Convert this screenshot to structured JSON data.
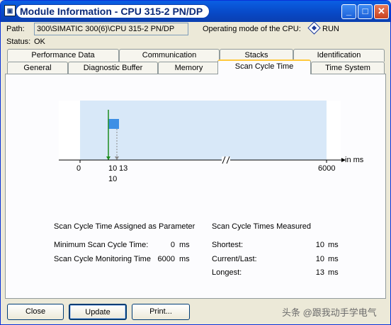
{
  "window": {
    "title": "Module Information - CPU 315-2 PN/DP",
    "icon": "siemens-cpu-icon"
  },
  "title_buttons": {
    "minimize": "_",
    "maximize": "□",
    "close": "✕"
  },
  "header": {
    "path_label": "Path:",
    "path_value": "300\\SIMATIC 300(6)\\CPU 315-2 PN/DP",
    "mode_label": "Operating mode of the  CPU:",
    "mode_value": "RUN",
    "status_label": "Status:",
    "status_value": "OK"
  },
  "tabs_back": [
    "Performance Data",
    "Communication",
    "Stacks",
    "Identification"
  ],
  "tabs_front": [
    "General",
    "Diagnostic Buffer",
    "Memory",
    "Scan Cycle Time",
    "Time System"
  ],
  "active_tab": "Scan Cycle Time",
  "chart_data": {
    "type": "bar",
    "xlabel": "in ms",
    "x_ticks": [
      "0",
      "10",
      "13",
      "6000"
    ],
    "x_tick_sub": "10",
    "axis_break": true,
    "shortest": 10,
    "current": 10,
    "longest": 13,
    "monitoring_max": 6000,
    "colors": {
      "band": "#d8e8f8",
      "bar": "#3d8fe5",
      "current_line": "#1e8c1e",
      "longest_line": "#8a8a8a"
    }
  },
  "params": {
    "title": "Scan Cycle Time Assigned as Parameter",
    "rows": [
      {
        "label": "Minimum Scan Cycle Time:",
        "value": "0",
        "unit": "ms"
      },
      {
        "label": "Scan Cycle Monitoring Time",
        "value": "6000",
        "unit": "ms"
      }
    ]
  },
  "measured": {
    "title": "Scan Cycle Times Measured",
    "rows": [
      {
        "label": "Shortest:",
        "value": "10",
        "unit": "ms"
      },
      {
        "label": "Current/Last:",
        "value": "10",
        "unit": "ms"
      },
      {
        "label": "Longest:",
        "value": "13",
        "unit": "ms"
      }
    ]
  },
  "buttons": {
    "close": "Close",
    "update": "Update",
    "print": "Print..."
  },
  "watermark": "头条 @跟我动手学电气"
}
